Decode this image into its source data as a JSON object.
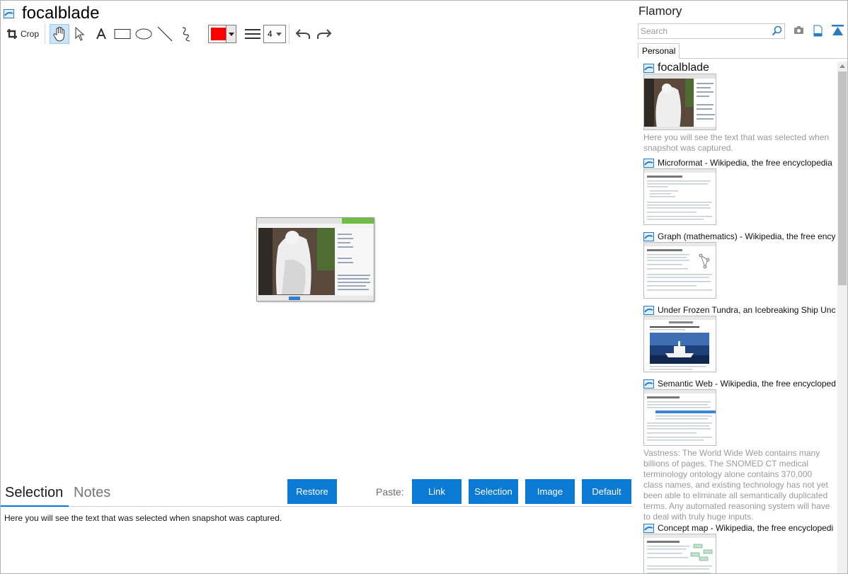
{
  "app_title": "focalblade",
  "toolbar": {
    "crop_label": "Crop",
    "color": "#ff0000",
    "line_width": "4"
  },
  "tabs": {
    "selection": "Selection",
    "notes": "Notes"
  },
  "buttons": {
    "restore": "Restore",
    "paste_label": "Paste:",
    "link": "Link",
    "selection": "Selection",
    "image": "Image",
    "default": "Default"
  },
  "selection_text": "Here you will see the text that was selected when snapshot was captured.",
  "panel": {
    "title": "Flamory",
    "search_placeholder": "Search",
    "tab_personal": "Personal",
    "items": [
      {
        "title": "focalblade",
        "note": "Here you will see the text that was selected when snapshot was captured."
      },
      {
        "title": "Microformat - Wikipedia, the free encyclopedia",
        "note": ""
      },
      {
        "title": "Graph (mathematics) - Wikipedia, the free encyc",
        "note": ""
      },
      {
        "title": "Under Frozen Tundra, an Icebreaking Ship Unco",
        "note": ""
      },
      {
        "title": "Semantic Web - Wikipedia, the free encycloped",
        "note": "Vastness: The World Wide Web contains many billions of pages. The SNOMED CT medical terminology ontology alone contains 370,000 class names, and existing technology has not yet been able to eliminate all semantically duplicated terms. Any automated reasoning system will have to deal with truly huge inputs."
      },
      {
        "title": "Concept map - Wikipedia, the free encyclopedi",
        "note": ""
      }
    ]
  },
  "colors": {
    "accent": "#0a7ad4",
    "selected_tool_bg": "#cce4f7",
    "note_text": "#9a9a9a"
  }
}
